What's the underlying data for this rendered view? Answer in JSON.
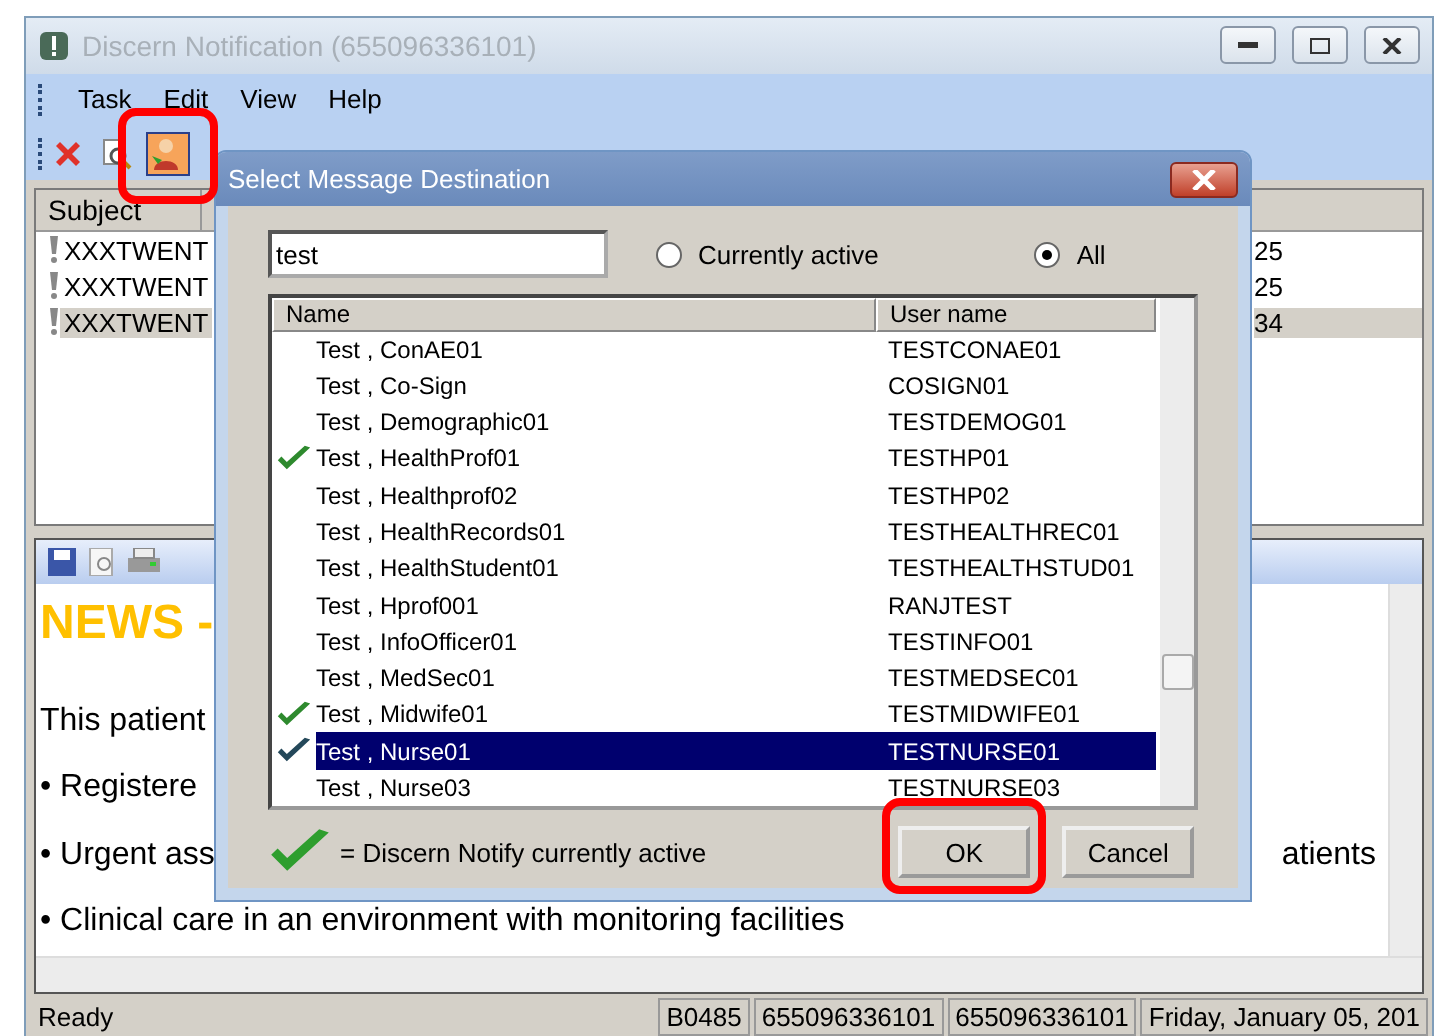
{
  "window": {
    "title": "Discern Notification (655096336101)"
  },
  "menu": [
    "Task",
    "Edit",
    "View",
    "Help"
  ],
  "toolbar": [
    {
      "kind": "delete",
      "pressed": false
    },
    {
      "kind": "preview",
      "pressed": false
    },
    {
      "kind": "destination",
      "pressed": true,
      "annotated": true
    }
  ],
  "messages": {
    "header": "Subject",
    "rows": [
      {
        "subject": "XXXTWENT",
        "column_2": "25",
        "selected": false
      },
      {
        "subject": "XXXTWENT",
        "column_2": "25",
        "selected": false
      },
      {
        "subject": "XXXTWENT",
        "column_2": "34",
        "selected": true
      }
    ]
  },
  "message_body": {
    "heading": "NEWS -",
    "lines": [
      {
        "text": "This patient"
      },
      {
        "text": "• Registere"
      },
      {
        "text": "• Urgent ass",
        "tail": "atients"
      },
      {
        "text": "• Clinical care in an environment with monitoring facilities"
      }
    ]
  },
  "status_bar": [
    "Ready",
    "B0485",
    "655096336101",
    "655096336101",
    "Friday, January 05, 201"
  ],
  "dialog": {
    "title": "Select Message Destination",
    "search": {
      "value": "test"
    },
    "filters": [
      {
        "label": "Currently active",
        "selected": false
      },
      {
        "label": "All",
        "selected": true
      }
    ],
    "columns": [
      "Name",
      "User name"
    ],
    "rows": [
      {
        "name": "Test , ConAE01",
        "user": "TESTCONAE01",
        "active": false,
        "selected": false
      },
      {
        "name": "Test , Co-Sign",
        "user": "COSIGN01",
        "active": false,
        "selected": false
      },
      {
        "name": "Test , Demographic01",
        "user": "TESTDEMOG01",
        "active": false,
        "selected": false
      },
      {
        "name": "Test , HealthProf01",
        "user": "TESTHP01",
        "active": true,
        "selected": false
      },
      {
        "name": "Test , Healthprof02",
        "user": "TESTHP02",
        "active": false,
        "selected": false
      },
      {
        "name": "Test , HealthRecords01",
        "user": "TESTHEALTHREC01",
        "active": false,
        "selected": false
      },
      {
        "name": "Test , HealthStudent01",
        "user": "TESTHEALTHSTUD01",
        "active": false,
        "selected": false
      },
      {
        "name": "Test , Hprof001",
        "user": "RANJTEST",
        "active": false,
        "selected": false
      },
      {
        "name": "Test , InfoOfficer01",
        "user": "TESTINFO01",
        "active": false,
        "selected": false
      },
      {
        "name": "Test , MedSec01",
        "user": "TESTMEDSEC01",
        "active": false,
        "selected": false
      },
      {
        "name": "Test , Midwife01",
        "user": "TESTMIDWIFE01",
        "active": true,
        "selected": false
      },
      {
        "name": "Test , Nurse01",
        "user": "TESTNURSE01",
        "active": true,
        "selected": true
      },
      {
        "name": "Test , Nurse03",
        "user": "TESTNURSE03",
        "active": false,
        "selected": false
      }
    ],
    "legend": "= Discern Notify currently active",
    "buttons": [
      {
        "label": "OK",
        "annotated": true
      },
      {
        "label": "Cancel"
      }
    ]
  }
}
